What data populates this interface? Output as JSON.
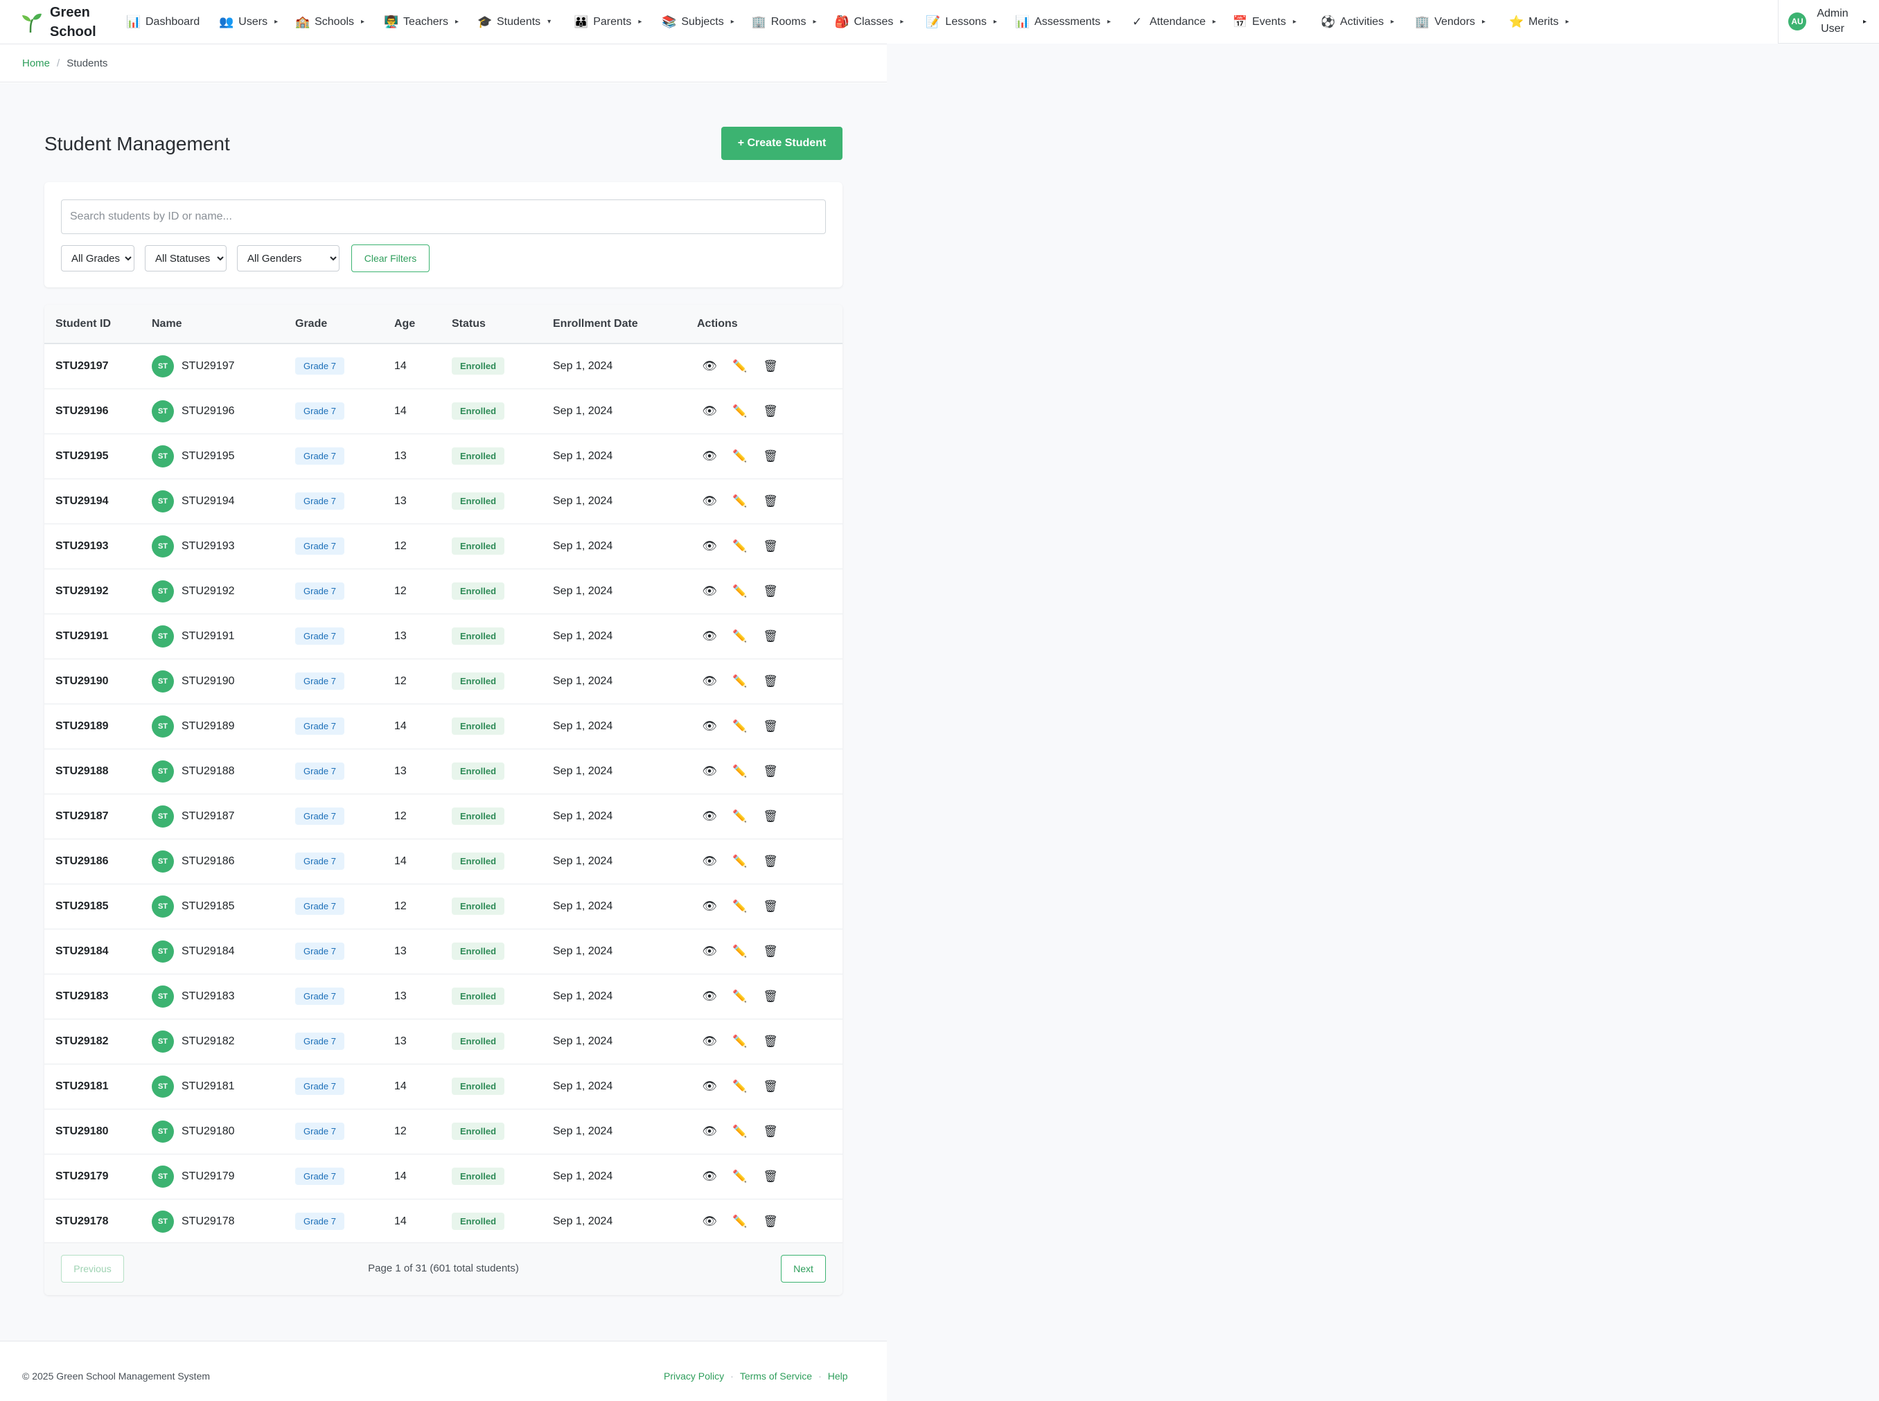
{
  "brand": {
    "name_line1": "Green",
    "name_line2": "School"
  },
  "nav": [
    {
      "label": "Dashboard",
      "icon": "chart-icon",
      "glyph": "📊",
      "caret": ""
    },
    {
      "label": "Users",
      "icon": "users-icon",
      "glyph": "👥",
      "caret": "▸"
    },
    {
      "label": "Schools",
      "icon": "school-icon",
      "glyph": "🏫",
      "caret": "▸"
    },
    {
      "label": "Teachers",
      "icon": "teacher-icon",
      "glyph": "👨‍🏫",
      "caret": "▸"
    },
    {
      "label": "Students",
      "icon": "graduation-cap-icon",
      "glyph": "🎓",
      "caret": "▾"
    },
    {
      "label": "Parents",
      "icon": "family-icon",
      "glyph": "👪",
      "caret": "▸"
    },
    {
      "label": "Subjects",
      "icon": "books-icon",
      "glyph": "📚",
      "caret": "▸"
    },
    {
      "label": "Rooms",
      "icon": "building-icon",
      "glyph": "🏢",
      "caret": "▸"
    },
    {
      "label": "Classes",
      "icon": "backpack-icon",
      "glyph": "🎒",
      "caret": "▸"
    },
    {
      "label": "Lessons",
      "icon": "memo-icon",
      "glyph": "📝",
      "caret": "▸"
    },
    {
      "label": "Assessments",
      "icon": "bar-chart-icon",
      "glyph": "📊",
      "caret": "▸"
    },
    {
      "label": "Attendance",
      "icon": "checkmark-icon",
      "glyph": "✓",
      "caret": "▸"
    },
    {
      "label": "Events",
      "icon": "calendar-icon",
      "glyph": "📅",
      "caret": "▸"
    },
    {
      "label": "Activities",
      "icon": "soccer-ball-icon",
      "glyph": "⚽",
      "caret": "▸"
    },
    {
      "label": "Vendors",
      "icon": "office-icon",
      "glyph": "🏢",
      "caret": "▸"
    },
    {
      "label": "Merits",
      "icon": "star-icon",
      "glyph": "⭐",
      "caret": "▸"
    }
  ],
  "user": {
    "initials": "AU",
    "name_line1": "Admin",
    "name_line2": "User",
    "caret": "▸"
  },
  "breadcrumb": {
    "home": "Home",
    "separator": "/",
    "current": "Students"
  },
  "page": {
    "title": "Student Management",
    "create_button": "+ Create Student"
  },
  "filters": {
    "search_placeholder": "Search students by ID or name...",
    "grade": "All Grades",
    "status": "All Statuses",
    "gender": "All Genders",
    "clear_button": "Clear Filters"
  },
  "table": {
    "headers": {
      "id": "Student ID",
      "name": "Name",
      "grade": "Grade",
      "age": "Age",
      "status": "Status",
      "enrollment": "Enrollment Date",
      "actions": "Actions"
    },
    "rows": [
      {
        "id": "STU29197",
        "initials": "ST",
        "name": "STU29197",
        "grade": "Grade 7",
        "age": "14",
        "status": "Enrolled",
        "enrollment": "Sep 1, 2024"
      },
      {
        "id": "STU29196",
        "initials": "ST",
        "name": "STU29196",
        "grade": "Grade 7",
        "age": "14",
        "status": "Enrolled",
        "enrollment": "Sep 1, 2024"
      },
      {
        "id": "STU29195",
        "initials": "ST",
        "name": "STU29195",
        "grade": "Grade 7",
        "age": "13",
        "status": "Enrolled",
        "enrollment": "Sep 1, 2024"
      },
      {
        "id": "STU29194",
        "initials": "ST",
        "name": "STU29194",
        "grade": "Grade 7",
        "age": "13",
        "status": "Enrolled",
        "enrollment": "Sep 1, 2024"
      },
      {
        "id": "STU29193",
        "initials": "ST",
        "name": "STU29193",
        "grade": "Grade 7",
        "age": "12",
        "status": "Enrolled",
        "enrollment": "Sep 1, 2024"
      },
      {
        "id": "STU29192",
        "initials": "ST",
        "name": "STU29192",
        "grade": "Grade 7",
        "age": "12",
        "status": "Enrolled",
        "enrollment": "Sep 1, 2024"
      },
      {
        "id": "STU29191",
        "initials": "ST",
        "name": "STU29191",
        "grade": "Grade 7",
        "age": "13",
        "status": "Enrolled",
        "enrollment": "Sep 1, 2024"
      },
      {
        "id": "STU29190",
        "initials": "ST",
        "name": "STU29190",
        "grade": "Grade 7",
        "age": "12",
        "status": "Enrolled",
        "enrollment": "Sep 1, 2024"
      },
      {
        "id": "STU29189",
        "initials": "ST",
        "name": "STU29189",
        "grade": "Grade 7",
        "age": "14",
        "status": "Enrolled",
        "enrollment": "Sep 1, 2024"
      },
      {
        "id": "STU29188",
        "initials": "ST",
        "name": "STU29188",
        "grade": "Grade 7",
        "age": "13",
        "status": "Enrolled",
        "enrollment": "Sep 1, 2024"
      },
      {
        "id": "STU29187",
        "initials": "ST",
        "name": "STU29187",
        "grade": "Grade 7",
        "age": "12",
        "status": "Enrolled",
        "enrollment": "Sep 1, 2024"
      },
      {
        "id": "STU29186",
        "initials": "ST",
        "name": "STU29186",
        "grade": "Grade 7",
        "age": "14",
        "status": "Enrolled",
        "enrollment": "Sep 1, 2024"
      },
      {
        "id": "STU29185",
        "initials": "ST",
        "name": "STU29185",
        "grade": "Grade 7",
        "age": "12",
        "status": "Enrolled",
        "enrollment": "Sep 1, 2024"
      },
      {
        "id": "STU29184",
        "initials": "ST",
        "name": "STU29184",
        "grade": "Grade 7",
        "age": "13",
        "status": "Enrolled",
        "enrollment": "Sep 1, 2024"
      },
      {
        "id": "STU29183",
        "initials": "ST",
        "name": "STU29183",
        "grade": "Grade 7",
        "age": "13",
        "status": "Enrolled",
        "enrollment": "Sep 1, 2024"
      },
      {
        "id": "STU29182",
        "initials": "ST",
        "name": "STU29182",
        "grade": "Grade 7",
        "age": "13",
        "status": "Enrolled",
        "enrollment": "Sep 1, 2024"
      },
      {
        "id": "STU29181",
        "initials": "ST",
        "name": "STU29181",
        "grade": "Grade 7",
        "age": "14",
        "status": "Enrolled",
        "enrollment": "Sep 1, 2024"
      },
      {
        "id": "STU29180",
        "initials": "ST",
        "name": "STU29180",
        "grade": "Grade 7",
        "age": "12",
        "status": "Enrolled",
        "enrollment": "Sep 1, 2024"
      },
      {
        "id": "STU29179",
        "initials": "ST",
        "name": "STU29179",
        "grade": "Grade 7",
        "age": "14",
        "status": "Enrolled",
        "enrollment": "Sep 1, 2024"
      },
      {
        "id": "STU29178",
        "initials": "ST",
        "name": "STU29178",
        "grade": "Grade 7",
        "age": "14",
        "status": "Enrolled",
        "enrollment": "Sep 1, 2024"
      }
    ],
    "action_icons": {
      "view": "👁",
      "edit": "✏️",
      "delete": "🗑"
    }
  },
  "pagination": {
    "previous": "Previous",
    "info": "Page 1 of 31 (601 total students)",
    "next": "Next"
  },
  "footer": {
    "copyright": "© 2025 Green School Management System",
    "links": [
      "Privacy Policy",
      "Terms of Service",
      "Help"
    ],
    "separator": "·"
  },
  "colors": {
    "accent": "#3cb371",
    "grade_badge_bg": "#e7f3fd",
    "status_badge_bg": "#e8f5ec"
  }
}
